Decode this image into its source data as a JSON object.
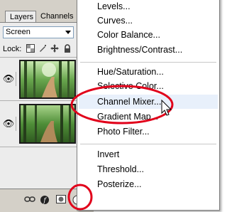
{
  "layers_panel": {
    "tabs": [
      "Layers",
      "Channels"
    ],
    "blend_mode": "Screen",
    "lock_label": "Lock:"
  },
  "menu": {
    "items": [
      "Levels...",
      "Curves...",
      "Color Balance...",
      "Brightness/Contrast...",
      "Hue/Saturation...",
      "Selective Color...",
      "Channel Mixer...",
      "Gradient Map...",
      "Photo Filter...",
      "Invert",
      "Threshold...",
      "Posterize..."
    ],
    "highlighted": "Channel Mixer..."
  },
  "annotation_color": "#e1001a"
}
